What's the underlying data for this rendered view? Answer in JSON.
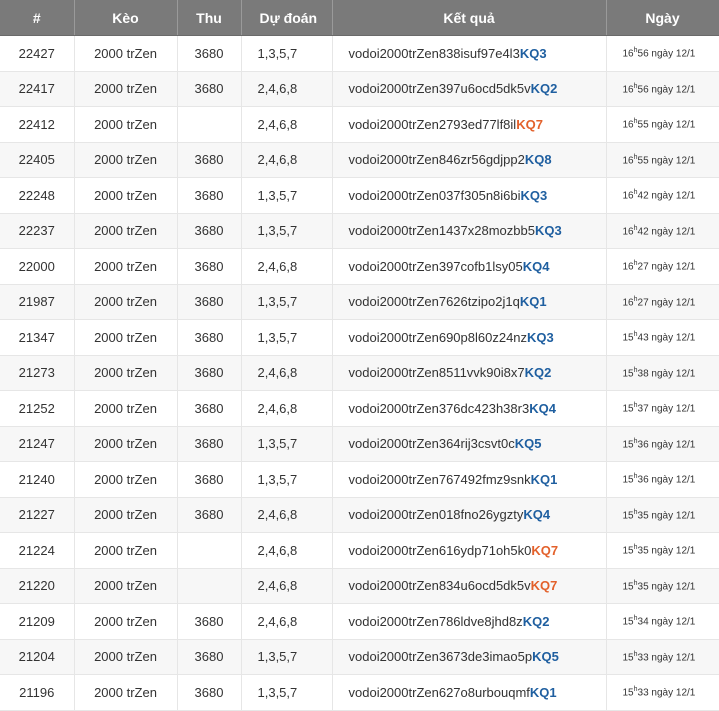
{
  "colors": {
    "header_bg": "#7a7a7a",
    "kq_blue": "#1f5fa0",
    "kq_orange": "#e3612b"
  },
  "headers": [
    "#",
    "Kèo",
    "Thu",
    "Dự đoán",
    "Kết quả",
    "Ngày"
  ],
  "rows": [
    {
      "id": "22427",
      "keo": "2000 trZen",
      "thu": "3680",
      "du_doan": "1,3,5,7",
      "ket_qua": "vodoi2000trZen838isuf97e4l3",
      "kq": "KQ3",
      "kq_color": "blue",
      "hour": "16",
      "min": "56",
      "day": " ngày 12/1"
    },
    {
      "id": "22417",
      "keo": "2000 trZen",
      "thu": "3680",
      "du_doan": "2,4,6,8",
      "ket_qua": "vodoi2000trZen397u6ocd5dk5v",
      "kq": "KQ2",
      "kq_color": "blue",
      "hour": "16",
      "min": "56",
      "day": " ngày 12/1"
    },
    {
      "id": "22412",
      "keo": "2000 trZen",
      "thu": "",
      "du_doan": "2,4,6,8",
      "ket_qua": "vodoi2000trZen2793ed77lf8il",
      "kq": "KQ7",
      "kq_color": "orange",
      "hour": "16",
      "min": "55",
      "day": " ngày 12/1"
    },
    {
      "id": "22405",
      "keo": "2000 trZen",
      "thu": "3680",
      "du_doan": "2,4,6,8",
      "ket_qua": "vodoi2000trZen846zr56gdjpp2",
      "kq": "KQ8",
      "kq_color": "blue",
      "hour": "16",
      "min": "55",
      "day": " ngày 12/1"
    },
    {
      "id": "22248",
      "keo": "2000 trZen",
      "thu": "3680",
      "du_doan": "1,3,5,7",
      "ket_qua": "vodoi2000trZen037f305n8i6bi",
      "kq": "KQ3",
      "kq_color": "blue",
      "hour": "16",
      "min": "42",
      "day": " ngày 12/1"
    },
    {
      "id": "22237",
      "keo": "2000 trZen",
      "thu": "3680",
      "du_doan": "1,3,5,7",
      "ket_qua": "vodoi2000trZen1437x28mozbb5",
      "kq": "KQ3",
      "kq_color": "blue",
      "hour": "16",
      "min": "42",
      "day": " ngày 12/1"
    },
    {
      "id": "22000",
      "keo": "2000 trZen",
      "thu": "3680",
      "du_doan": "2,4,6,8",
      "ket_qua": "vodoi2000trZen397cofb1lsy05",
      "kq": "KQ4",
      "kq_color": "blue",
      "hour": "16",
      "min": "27",
      "day": " ngày 12/1"
    },
    {
      "id": "21987",
      "keo": "2000 trZen",
      "thu": "3680",
      "du_doan": "1,3,5,7",
      "ket_qua": "vodoi2000trZen7626tzipo2j1q",
      "kq": "KQ1",
      "kq_color": "blue",
      "hour": "16",
      "min": "27",
      "day": " ngày 12/1"
    },
    {
      "id": "21347",
      "keo": "2000 trZen",
      "thu": "3680",
      "du_doan": "1,3,5,7",
      "ket_qua": "vodoi2000trZen690p8l60z24nz",
      "kq": "KQ3",
      "kq_color": "blue",
      "hour": "15",
      "min": "43",
      "day": " ngày 12/1"
    },
    {
      "id": "21273",
      "keo": "2000 trZen",
      "thu": "3680",
      "du_doan": "2,4,6,8",
      "ket_qua": "vodoi2000trZen8511vvk90i8x7",
      "kq": "KQ2",
      "kq_color": "blue",
      "hour": "15",
      "min": "38",
      "day": " ngày 12/1"
    },
    {
      "id": "21252",
      "keo": "2000 trZen",
      "thu": "3680",
      "du_doan": "2,4,6,8",
      "ket_qua": "vodoi2000trZen376dc423h38r3",
      "kq": "KQ4",
      "kq_color": "blue",
      "hour": "15",
      "min": "37",
      "day": " ngày 12/1"
    },
    {
      "id": "21247",
      "keo": "2000 trZen",
      "thu": "3680",
      "du_doan": "1,3,5,7",
      "ket_qua": "vodoi2000trZen364rij3csvt0c",
      "kq": "KQ5",
      "kq_color": "blue",
      "hour": "15",
      "min": "36",
      "day": " ngày 12/1"
    },
    {
      "id": "21240",
      "keo": "2000 trZen",
      "thu": "3680",
      "du_doan": "1,3,5,7",
      "ket_qua": "vodoi2000trZen767492fmz9snk",
      "kq": "KQ1",
      "kq_color": "blue",
      "hour": "15",
      "min": "36",
      "day": " ngày 12/1"
    },
    {
      "id": "21227",
      "keo": "2000 trZen",
      "thu": "3680",
      "du_doan": "2,4,6,8",
      "ket_qua": "vodoi2000trZen018fno26ygzty",
      "kq": "KQ4",
      "kq_color": "blue",
      "hour": "15",
      "min": "35",
      "day": " ngày 12/1"
    },
    {
      "id": "21224",
      "keo": "2000 trZen",
      "thu": "",
      "du_doan": "2,4,6,8",
      "ket_qua": "vodoi2000trZen616ydp71oh5k0",
      "kq": "KQ7",
      "kq_color": "orange",
      "hour": "15",
      "min": "35",
      "day": " ngày 12/1"
    },
    {
      "id": "21220",
      "keo": "2000 trZen",
      "thu": "",
      "du_doan": "2,4,6,8",
      "ket_qua": "vodoi2000trZen834u6ocd5dk5v",
      "kq": "KQ7",
      "kq_color": "orange",
      "hour": "15",
      "min": "35",
      "day": " ngày 12/1"
    },
    {
      "id": "21209",
      "keo": "2000 trZen",
      "thu": "3680",
      "du_doan": "2,4,6,8",
      "ket_qua": "vodoi2000trZen786ldve8jhd8z",
      "kq": "KQ2",
      "kq_color": "blue",
      "hour": "15",
      "min": "34",
      "day": " ngày 12/1"
    },
    {
      "id": "21204",
      "keo": "2000 trZen",
      "thu": "3680",
      "du_doan": "1,3,5,7",
      "ket_qua": "vodoi2000trZen3673de3imao5p",
      "kq": "KQ5",
      "kq_color": "blue",
      "hour": "15",
      "min": "33",
      "day": " ngày 12/1"
    },
    {
      "id": "21196",
      "keo": "2000 trZen",
      "thu": "3680",
      "du_doan": "1,3,5,7",
      "ket_qua": "vodoi2000trZen627o8urbouqmf",
      "kq": "KQ1",
      "kq_color": "blue",
      "hour": "15",
      "min": "33",
      "day": " ngày 12/1"
    }
  ]
}
